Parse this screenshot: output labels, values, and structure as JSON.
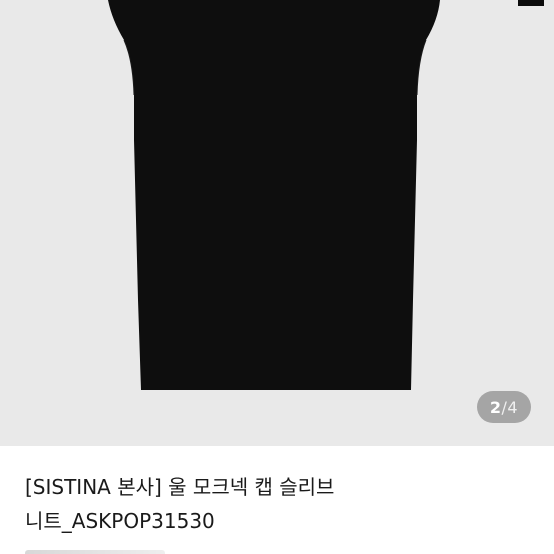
{
  "gallery": {
    "current_page": "2",
    "separator": "/",
    "total_pages": "4"
  },
  "product": {
    "title_line1": "[SISTINA 본사] 울 모크넥 캡 슬리브",
    "title_line2": "니트_ASKPOP31530"
  },
  "colors": {
    "image_background": "#e9e9e9",
    "garment": "#0e0e0e",
    "indicator_background": "#6e6e6e"
  }
}
